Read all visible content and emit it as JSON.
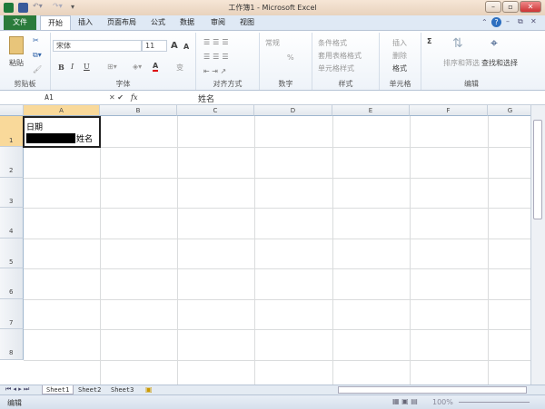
{
  "window": {
    "title": "工作簿1 - Microsoft Excel"
  },
  "tabs": [
    "文件",
    "开始",
    "插入",
    "页面布局",
    "公式",
    "数据",
    "审阅",
    "视图"
  ],
  "ribbon": {
    "clipboard": {
      "paste": "粘贴",
      "label": "剪贴板"
    },
    "font": {
      "name": "宋体",
      "size": "11",
      "bold": "B",
      "italic": "I",
      "underline": "U",
      "font_color": "A",
      "grow": "A",
      "shrink": "A",
      "phonetic": "变",
      "label": "字体"
    },
    "alignment": {
      "label": "对齐方式"
    },
    "number": {
      "format": "常规",
      "percent": "%",
      "label": "数字"
    },
    "styles": {
      "conditional": "条件格式",
      "table": "套用表格格式",
      "cell": "单元格样式",
      "label": "样式"
    },
    "cells": {
      "insert": "插入",
      "delete": "删除",
      "format": "格式",
      "label": "单元格"
    },
    "editing": {
      "sum": "Σ",
      "sort": "排序和筛选",
      "find": "查找和选择",
      "label": "编辑"
    }
  },
  "formula_bar": {
    "name_box": "A1",
    "fx": "fx",
    "content": "姓名"
  },
  "columns": [
    "A",
    "B",
    "C",
    "D",
    "E",
    "F",
    "G"
  ],
  "rows": [
    "1",
    "2",
    "3",
    "4",
    "5",
    "6",
    "7",
    "8"
  ],
  "cells": {
    "A1_line1": "日期",
    "A1_line2": "姓名"
  },
  "sheets": [
    "Sheet1",
    "Sheet2",
    "Sheet3"
  ],
  "status": {
    "mode": "编辑",
    "zoom": "100%"
  }
}
